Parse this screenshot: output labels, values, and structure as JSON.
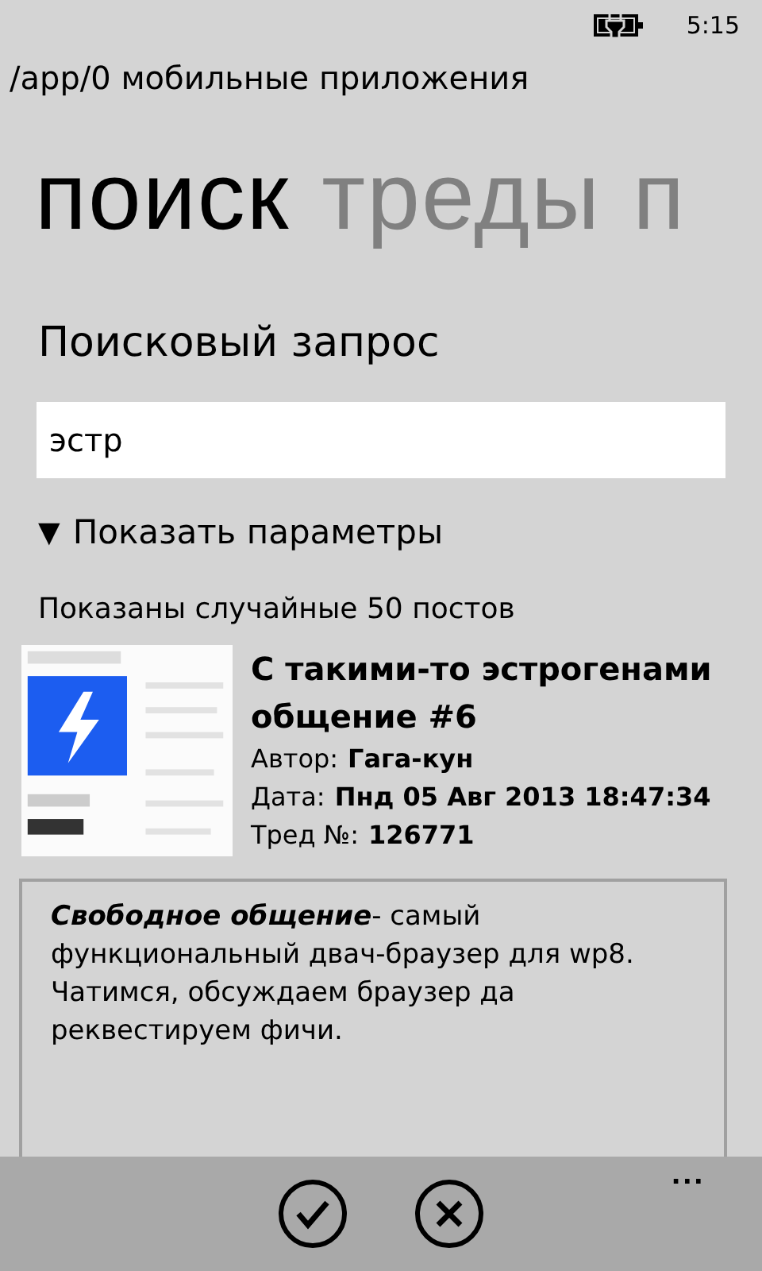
{
  "status_bar": {
    "time": "5:15"
  },
  "app_title": "/app/0 мобильные приложения",
  "pivot": [
    {
      "label": "поиск",
      "selected": true
    },
    {
      "label": "треды",
      "selected": false
    },
    {
      "label": "п",
      "selected": false
    }
  ],
  "search": {
    "label": "Поисковый запрос",
    "value": "эстр"
  },
  "options_toggle": {
    "icon": "▼",
    "label": "Показать параметры",
    "expanded": false
  },
  "results_caption": "Показаны случайные 50 постов",
  "result": {
    "title": "С такими-то эстрогенами общение #6",
    "fields": [
      {
        "label": "Автор:",
        "value": "Гага-кун"
      },
      {
        "label": "Дата:",
        "value": "Пнд 05 Авг 2013 18:47:34"
      },
      {
        "label": "Тред №:",
        "value": "126771"
      }
    ],
    "description": "**Свободное общение**- самый функциональный двач-браузер для wp8. Чатимся, обсуждаем браузер да реквестируем фичи."
  },
  "app_bar": {
    "buttons": [
      {
        "kind": "check"
      },
      {
        "kind": "close"
      }
    ],
    "more": "..."
  }
}
